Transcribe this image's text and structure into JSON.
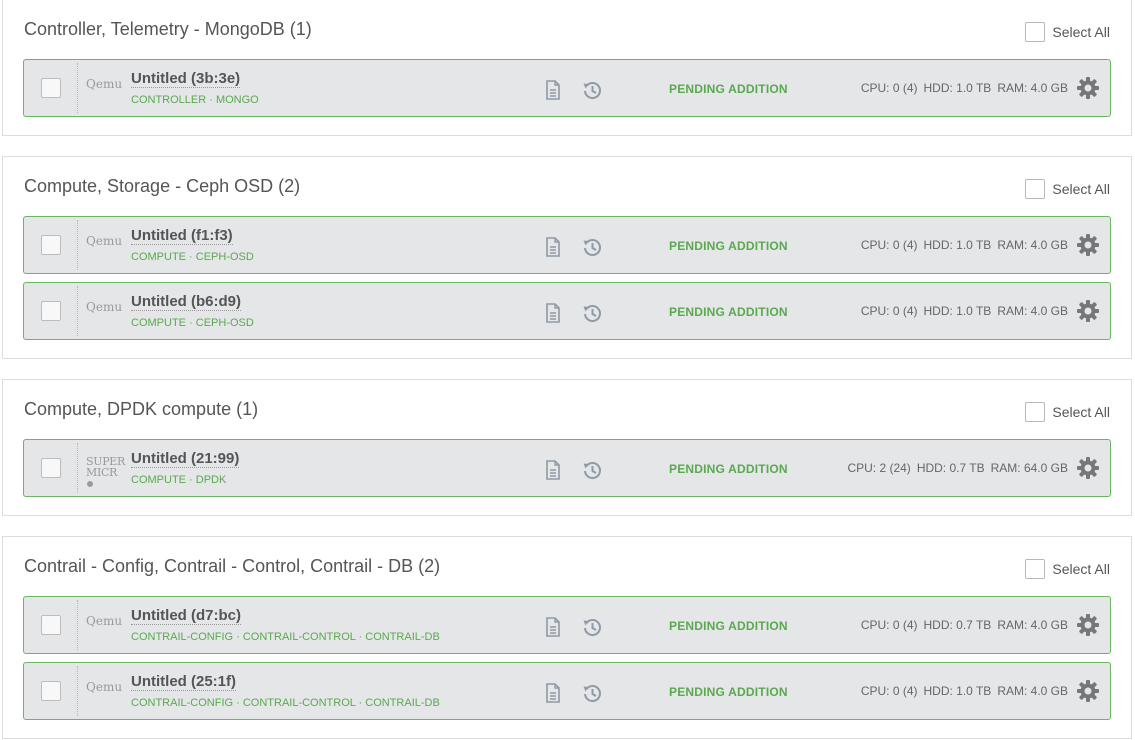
{
  "select_all_label": "Select All",
  "status_label": "PENDING ADDITION",
  "groups": [
    {
      "title": "Controller, Telemetry - MongoDB (1)",
      "nodes": [
        {
          "vendor": "Qemu",
          "name": "Untitled (3b:3e)",
          "roles": "CONTROLLER · MONGO",
          "cpu": "CPU: 0 (4)",
          "hdd": "HDD: 1.0 TB",
          "ram": "RAM: 4.0 GB"
        }
      ]
    },
    {
      "title": "Compute, Storage - Ceph OSD (2)",
      "nodes": [
        {
          "vendor": "Qemu",
          "name": "Untitled (f1:f3)",
          "roles": "COMPUTE · CEPH-OSD",
          "cpu": "CPU: 0 (4)",
          "hdd": "HDD: 1.0 TB",
          "ram": "RAM: 4.0 GB"
        },
        {
          "vendor": "Qemu",
          "name": "Untitled (b6:d9)",
          "roles": "COMPUTE · CEPH-OSD",
          "cpu": "CPU: 0 (4)",
          "hdd": "HDD: 1.0 TB",
          "ram": "RAM: 4.0 GB"
        }
      ]
    },
    {
      "title": "Compute, DPDK compute (1)",
      "nodes": [
        {
          "vendor_line1": "SUPER",
          "vendor_line2": "MICR",
          "name": "Untitled (21:99)",
          "roles": "COMPUTE · DPDK",
          "cpu": "CPU: 2 (24)",
          "hdd": "HDD: 0.7 TB",
          "ram": "RAM: 64.0 GB"
        }
      ]
    },
    {
      "title": "Contrail - Config, Contrail - Control, Contrail - DB (2)",
      "nodes": [
        {
          "vendor": "Qemu",
          "name": "Untitled (d7:bc)",
          "roles": "CONTRAIL-CONFIG · CONTRAIL-CONTROL · CONTRAIL-DB",
          "cpu": "CPU: 0 (4)",
          "hdd": "HDD: 0.7 TB",
          "ram": "RAM: 4.0 GB"
        },
        {
          "vendor": "Qemu",
          "name": "Untitled (25:1f)",
          "roles": "CONTRAIL-CONFIG · CONTRAIL-CONTROL · CONTRAIL-DB",
          "cpu": "CPU: 0 (4)",
          "hdd": "HDD: 1.0 TB",
          "ram": "RAM: 4.0 GB"
        }
      ]
    }
  ]
}
